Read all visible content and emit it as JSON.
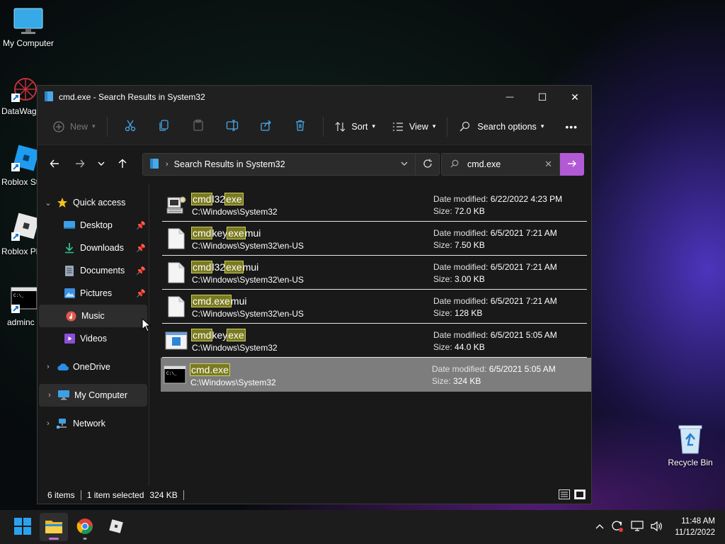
{
  "desktop": {
    "icons": [
      {
        "label": "My Computer"
      },
      {
        "label": "DataWag"
      },
      {
        "label": "Roblox St"
      },
      {
        "label": "Roblox Pl"
      },
      {
        "label": "adminc"
      },
      {
        "label": "Recycle Bin"
      }
    ]
  },
  "window": {
    "title": "cmd.exe - Search Results in System32",
    "controls": {
      "minimize": "—",
      "maximize": "☐",
      "close": "✕"
    },
    "toolbar": {
      "new_label": "New",
      "sort_label": "Sort",
      "view_label": "View",
      "search_options_label": "Search options",
      "more_label": "•••"
    },
    "address": {
      "crumb": "Search Results in System32"
    },
    "search": {
      "query": "cmd.exe"
    },
    "sidebar": {
      "quick_access": "Quick access",
      "items": [
        {
          "label": "Desktop"
        },
        {
          "label": "Downloads"
        },
        {
          "label": "Documents"
        },
        {
          "label": "Pictures"
        },
        {
          "label": "Music"
        },
        {
          "label": "Videos"
        }
      ],
      "onedrive": "OneDrive",
      "my_computer": "My Computer",
      "network": "Network"
    },
    "results": [
      {
        "name_parts": [
          "cmd",
          "l32",
          "exe",
          ""
        ],
        "path": "C:\\Windows\\System32",
        "modified": "6/22/2022 4:23 PM",
        "size": "72.0 KB"
      },
      {
        "name_parts": [
          "cmd",
          "key",
          "exe",
          "mui"
        ],
        "path": "C:\\Windows\\System32\\en-US",
        "modified": "6/5/2021 7:21 AM",
        "size": "7.50 KB"
      },
      {
        "name_parts": [
          "cmd",
          "l32",
          "exe",
          "mui"
        ],
        "path": "C:\\Windows\\System32\\en-US",
        "modified": "6/5/2021 7:21 AM",
        "size": "3.00 KB"
      },
      {
        "name_parts": [
          "cmd.exe",
          "",
          "",
          "mui"
        ],
        "path": "C:\\Windows\\System32\\en-US",
        "modified": "6/5/2021 7:21 AM",
        "size": "128 KB"
      },
      {
        "name_parts": [
          "cmd",
          "key",
          "exe",
          ""
        ],
        "path": "C:\\Windows\\System32",
        "modified": "6/5/2021 5:05 AM",
        "size": "44.0 KB"
      },
      {
        "name_parts": [
          "cmd.exe",
          "",
          "",
          ""
        ],
        "path": "C:\\Windows\\System32",
        "modified": "6/5/2021 5:05 AM",
        "size": "324 KB"
      }
    ],
    "labels": {
      "date_modified": "Date modified:",
      "size": "Size:"
    },
    "status": {
      "count": "6 items",
      "selected": "1 item selected",
      "selected_size": "324 KB"
    }
  },
  "taskbar": {
    "time": "11:48 AM",
    "date": "11/12/2022"
  },
  "colors": {
    "accent": "#b25ad6",
    "highlight": "#7a7a20",
    "selected_row": "#7d7d7d"
  }
}
